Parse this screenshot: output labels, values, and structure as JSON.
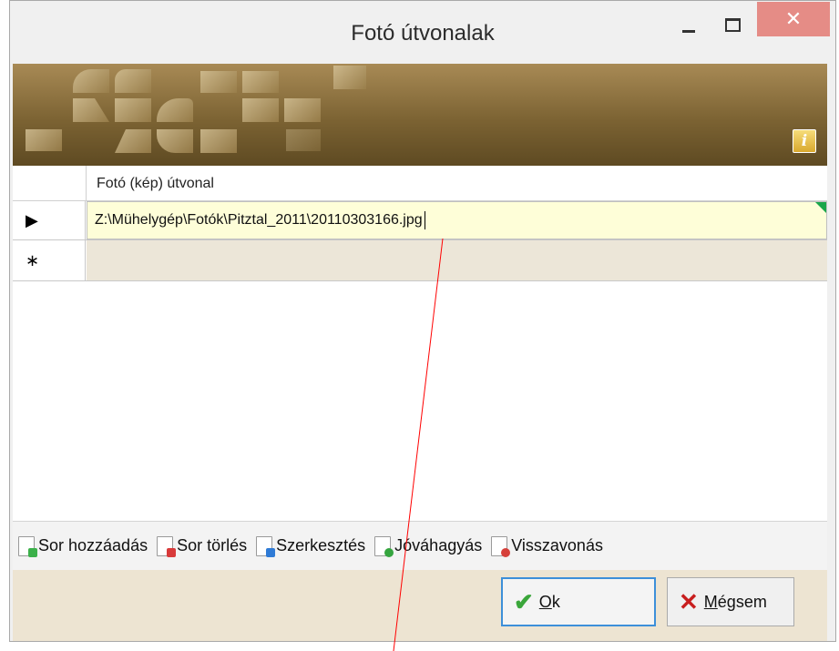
{
  "window": {
    "title": "Fotó útvonalak",
    "close_glyph": "✕"
  },
  "banner": {
    "info_icon": "info-icon",
    "info_glyph": "i"
  },
  "grid": {
    "column_header": "Fotó (kép) útvonal",
    "rows": [
      {
        "indicator": "▶",
        "value": "Z:\\Mühelygép\\Fotók\\Pitztal_2011\\20110303166.jpg"
      }
    ],
    "new_row_indicator": "∗"
  },
  "toolbar": {
    "add": "Sor hozzáadás",
    "delete": "Sor törlés",
    "edit": "Szerkesztés",
    "confirm": "Jóváhagyás",
    "undo": "Visszavonás"
  },
  "footer": {
    "ok_prefix": "",
    "ok_label_u": "O",
    "ok_label_rest": "k",
    "cancel_label_u": "M",
    "cancel_label_rest": "égsem"
  },
  "colors": {
    "active_cell": "#fefed8",
    "new_row": "#ece6d8",
    "footer": "#ede4d2",
    "close": "#e58c86",
    "annotation_line": "#ff0000"
  }
}
